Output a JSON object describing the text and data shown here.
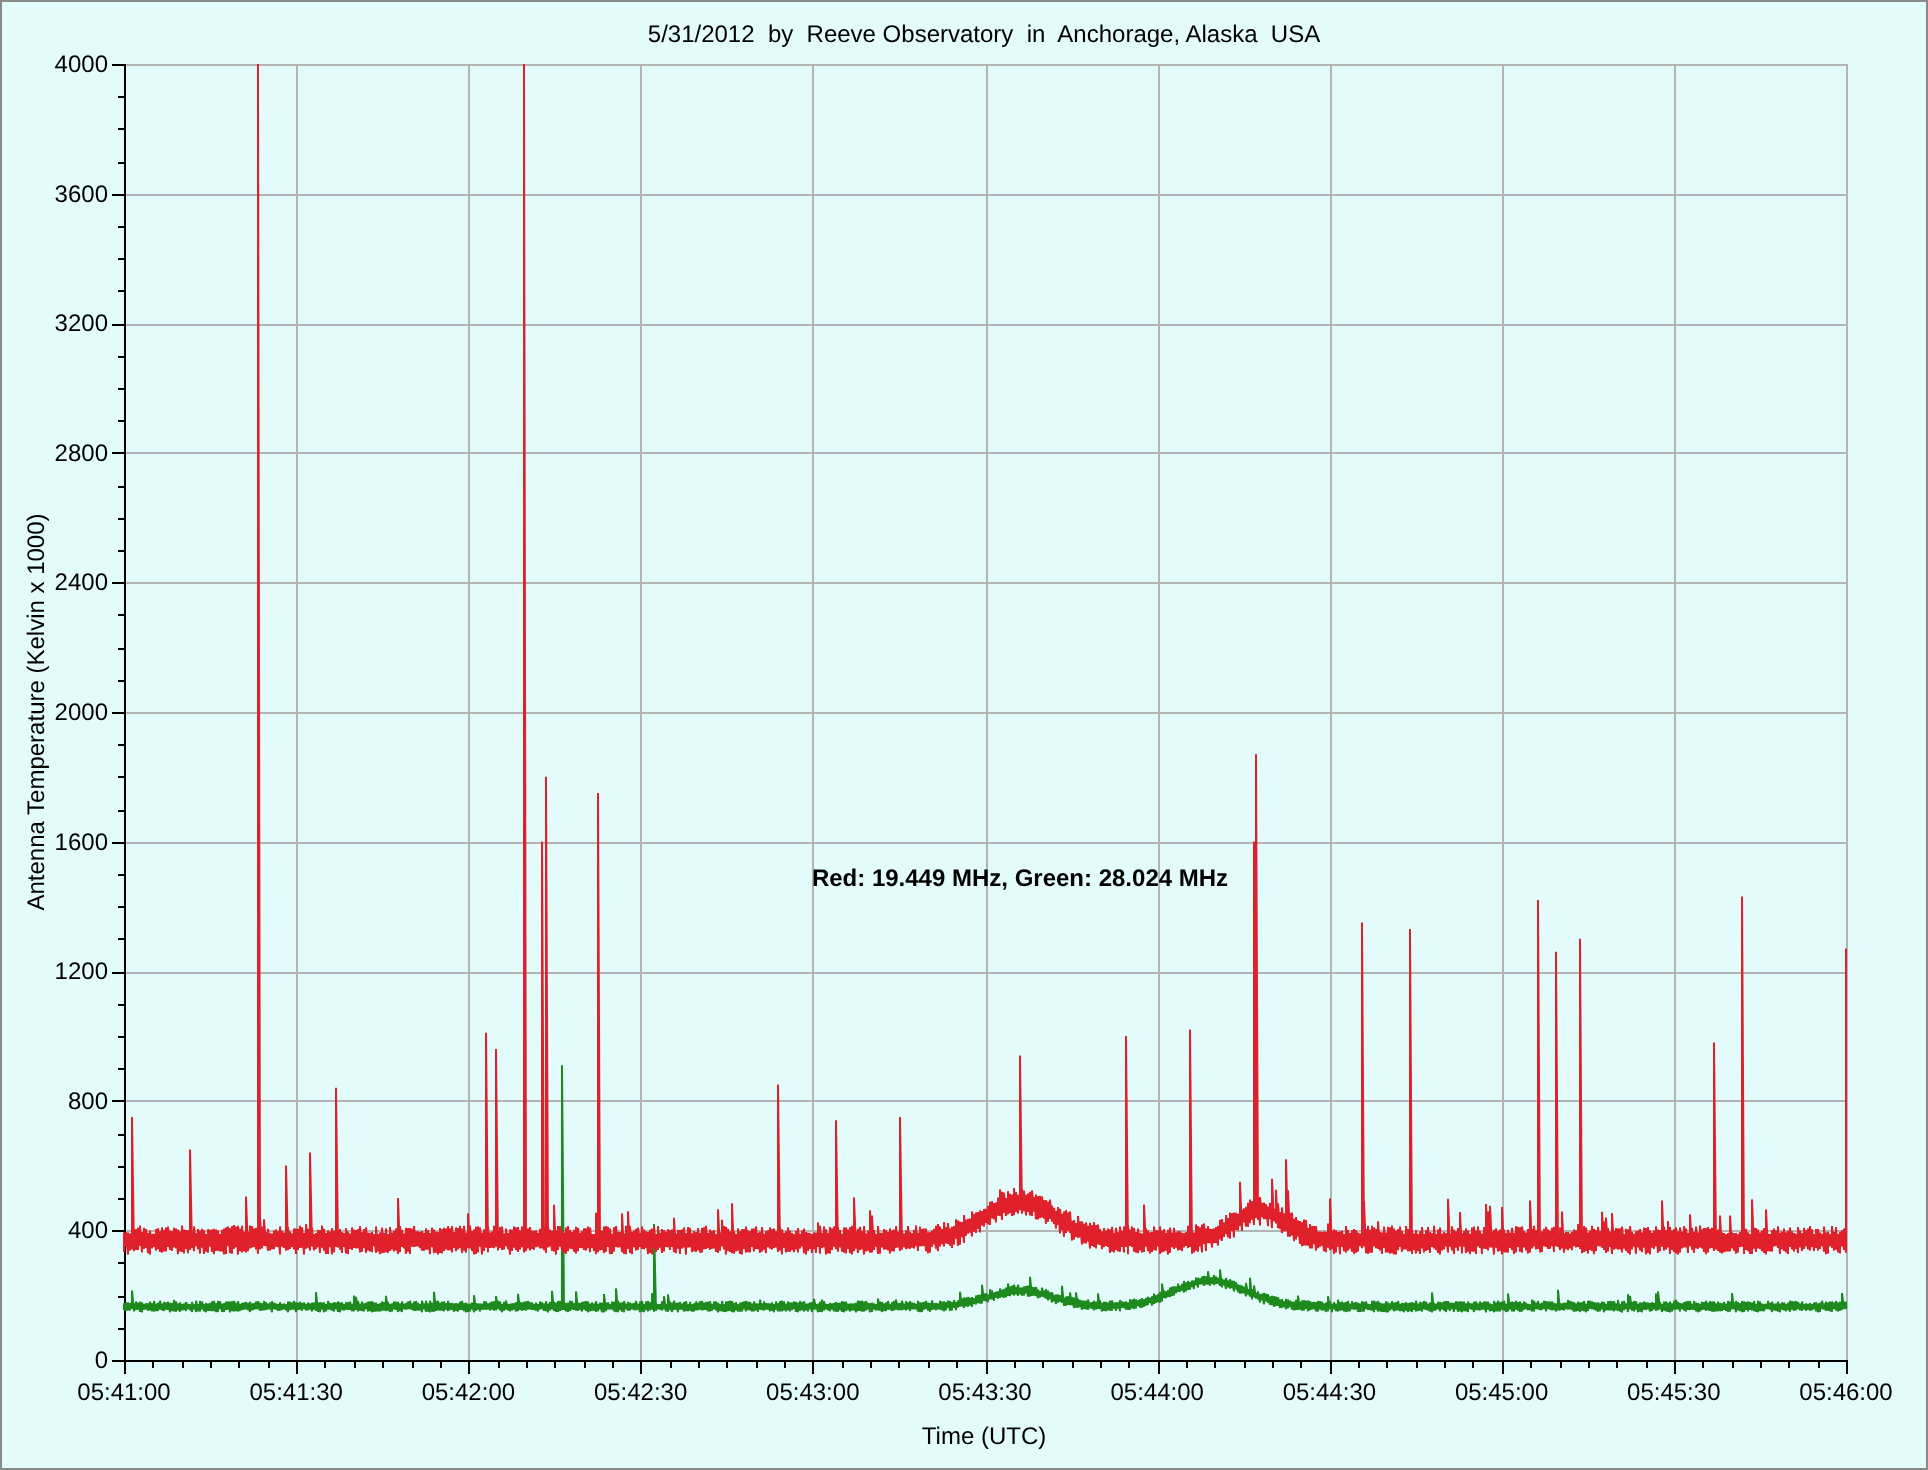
{
  "chart": {
    "title": "5/31/2012  by  Reeve Observatory  in  Anchorage, Alaska  USA",
    "ylabel": "Antenna Temperature (Kelvin x 1000)",
    "xlabel": "Time (UTC)",
    "y_tick_labels": [
      "4000",
      "3600",
      "3200",
      "2800",
      "2400",
      "2000",
      "1600",
      "1200",
      "800",
      "400",
      "0"
    ],
    "x_tick_labels": [
      "05:41:00",
      "05:41:30",
      "05:42:00",
      "05:42:30",
      "05:43:00",
      "05:43:30",
      "05:44:00",
      "05:44:30",
      "05:45:00",
      "05:45:30",
      "05:46:00"
    ],
    "annotation": "Red: 19.449 MHz, Green: 28.024 MHz"
  }
}
